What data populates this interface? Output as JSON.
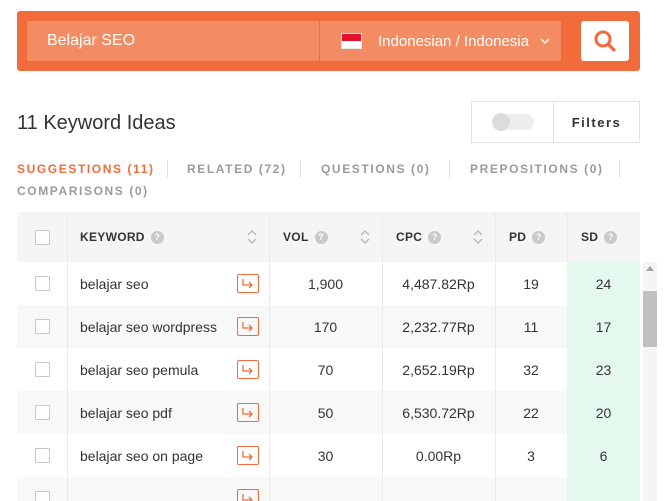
{
  "search": {
    "query": "Belajar SEO",
    "language": "Indonesian / Indonesia"
  },
  "heading": "11 Keyword Ideas",
  "filters": {
    "label": "Filters",
    "toggle_on": false
  },
  "tabs": [
    {
      "label": "SUGGESTIONS (11)",
      "active": true
    },
    {
      "label": "RELATED (72)",
      "active": false
    },
    {
      "label": "QUESTIONS (0)",
      "active": false
    },
    {
      "label": "PREPOSITIONS (0)",
      "active": false
    },
    {
      "label": "COMPARISONS (0)",
      "active": false
    }
  ],
  "table": {
    "columns": {
      "keyword": "KEYWORD",
      "vol": "VOL",
      "cpc": "CPC",
      "pd": "PD",
      "sd": "SD"
    },
    "rows": [
      {
        "keyword": "belajar seo",
        "vol": "1,900",
        "cpc": "4,487.82Rp",
        "pd": "19",
        "sd": "24"
      },
      {
        "keyword": "belajar seo wordpress",
        "vol": "170",
        "cpc": "2,232.77Rp",
        "pd": "11",
        "sd": "17"
      },
      {
        "keyword": "belajar seo pemula",
        "vol": "70",
        "cpc": "2,652.19Rp",
        "pd": "32",
        "sd": "23"
      },
      {
        "keyword": "belajar seo pdf",
        "vol": "50",
        "cpc": "6,530.72Rp",
        "pd": "22",
        "sd": "20"
      },
      {
        "keyword": "belajar seo on page",
        "vol": "30",
        "cpc": "0.00Rp",
        "pd": "3",
        "sd": "6"
      }
    ]
  },
  "colors": {
    "accent": "#f26b3a",
    "sd_cell": "#e5f8ee"
  }
}
